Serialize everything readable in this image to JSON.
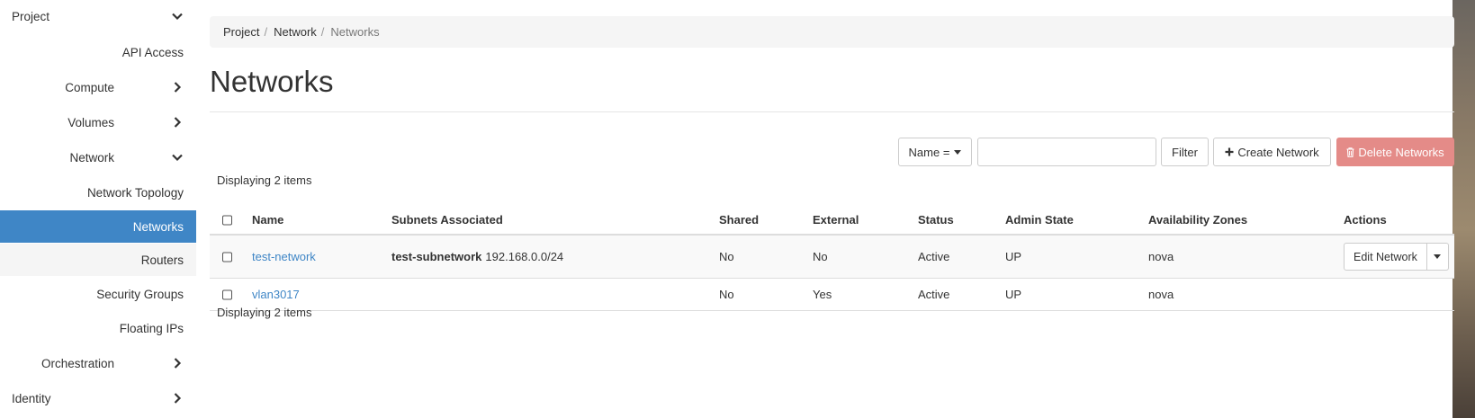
{
  "sidebar": {
    "project": "Project",
    "api_access": "API Access",
    "compute": "Compute",
    "volumes": "Volumes",
    "network": "Network",
    "network_topology": "Network Topology",
    "networks": "Networks",
    "routers": "Routers",
    "security_groups": "Security Groups",
    "floating_ips": "Floating IPs",
    "orchestration": "Orchestration",
    "identity": "Identity"
  },
  "breadcrumb": [
    "Project",
    "Network",
    "Networks"
  ],
  "page": {
    "title": "Networks"
  },
  "toolbar": {
    "filter_field": "Name =",
    "filter_value": "",
    "filter_label": "Filter",
    "create_label": "Create Network",
    "delete_label": "Delete Networks"
  },
  "table": {
    "count_top": "Displaying 2 items",
    "count_bottom": "Displaying 2 items",
    "columns": [
      "Name",
      "Subnets Associated",
      "Shared",
      "External",
      "Status",
      "Admin State",
      "Availability Zones",
      "Actions"
    ],
    "rows": [
      {
        "name": "test-network",
        "subnet_name": "test-subnetwork",
        "subnet_cidr": "192.168.0.0/24",
        "shared": "No",
        "external": "No",
        "status": "Active",
        "admin_state": "UP",
        "zones": "nova",
        "action": "Edit Network"
      },
      {
        "name": "vlan3017",
        "subnet_name": "",
        "subnet_cidr": "",
        "shared": "No",
        "external": "Yes",
        "status": "Active",
        "admin_state": "UP",
        "zones": "nova",
        "action": ""
      }
    ]
  },
  "colors": {
    "accent": "#3f86c6",
    "danger": "#e48b88",
    "link": "#3f86c6"
  },
  "icons": {
    "expanded": "chevron-down-icon",
    "collapsed": "chevron-right-icon",
    "create": "plus-icon",
    "delete": "trash-icon",
    "dropdown": "caret-down-icon"
  }
}
